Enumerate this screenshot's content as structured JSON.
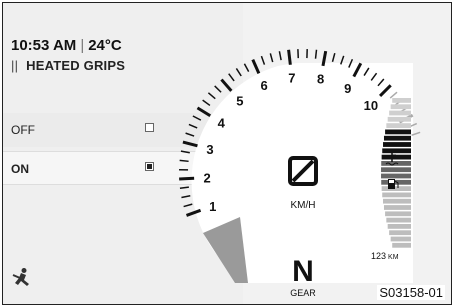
{
  "status": {
    "time": "10:53 AM",
    "temperature": "24°C"
  },
  "menu": {
    "title": "HEATED GRIPS",
    "options": [
      {
        "label": "OFF",
        "checked": false
      },
      {
        "label": "ON",
        "checked": true
      }
    ]
  },
  "tachometer": {
    "scale": [
      "1",
      "2",
      "3",
      "4",
      "5",
      "6",
      "7",
      "8",
      "9",
      "10"
    ]
  },
  "speed": {
    "unit": "KM/H"
  },
  "gear": {
    "value": "N",
    "label": "GEAR"
  },
  "range": {
    "value": "123",
    "unit": "KM"
  },
  "icons": [
    "rider-icon",
    "coolant-temperature-icon",
    "fuel-pump-icon",
    "menu-bars-icon",
    "speed-placeholder-icon"
  ],
  "figure_code": "S03158-01"
}
